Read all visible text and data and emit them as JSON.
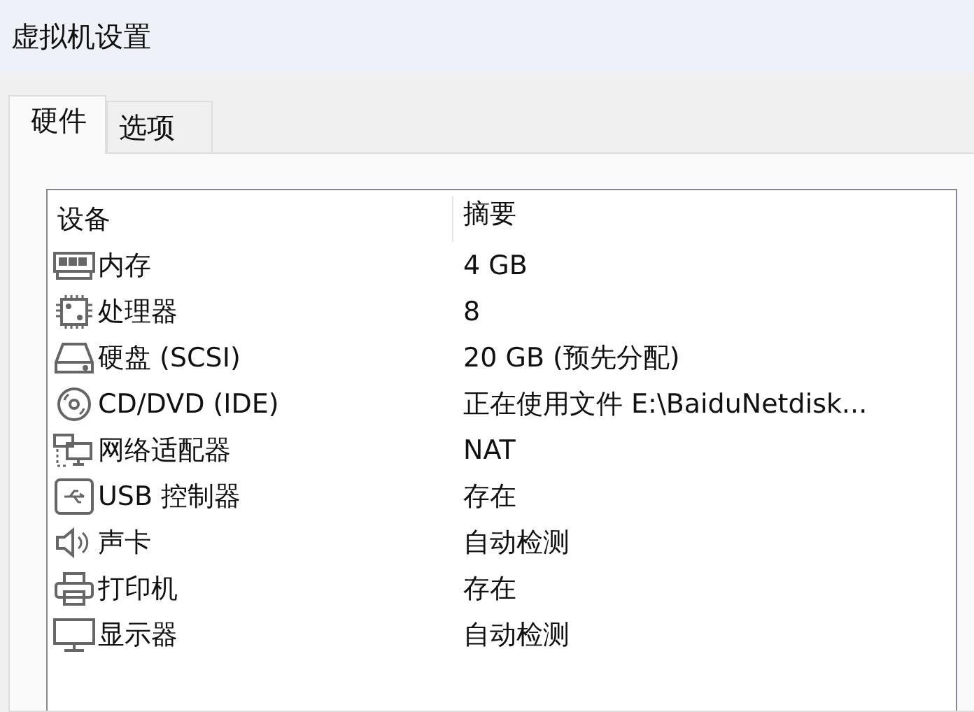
{
  "window": {
    "title": "虚拟机设置"
  },
  "tabs": [
    {
      "label": "硬件",
      "selected": true
    },
    {
      "label": "选项",
      "selected": false
    }
  ],
  "table": {
    "columns": [
      "设备",
      "摘要"
    ],
    "rows": [
      {
        "device": "内存",
        "summary": "4 GB"
      },
      {
        "device": "处理器",
        "summary": "8"
      },
      {
        "device": "硬盘 (SCSI)",
        "summary": "20 GB (预先分配)"
      },
      {
        "device": "CD/DVD (IDE)",
        "summary": "正在使用文件 E:\\BaiduNetdisk..."
      },
      {
        "device": "网络适配器",
        "summary": "NAT"
      },
      {
        "device": "USB 控制器",
        "summary": "存在"
      },
      {
        "device": "声卡",
        "summary": "自动检测"
      },
      {
        "device": "打印机",
        "summary": "存在"
      },
      {
        "device": "显示器",
        "summary": "自动检测"
      }
    ]
  }
}
